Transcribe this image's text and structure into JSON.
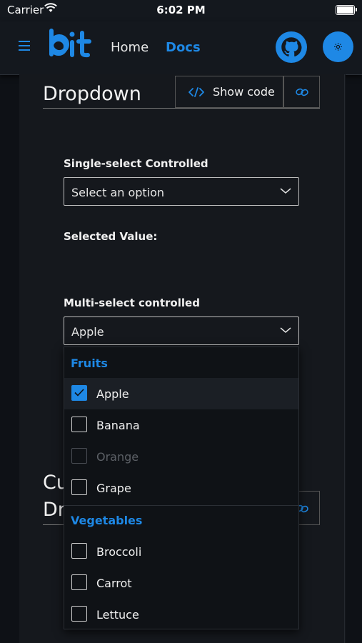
{
  "status_bar": {
    "carrier": "Carrier",
    "time": "6:02 PM"
  },
  "nav": {
    "logo": "bit",
    "home": "Home",
    "docs": "Docs",
    "github_icon": "github-icon",
    "theme_icon": "sun-icon"
  },
  "section": {
    "title": "Dropdown",
    "show_code": "Show code",
    "title2_line1": "Cu",
    "title2_line2": "Dr"
  },
  "single_select": {
    "label": "Single-select Controlled",
    "placeholder": "Select an option",
    "selected_value_label": "Selected Value:"
  },
  "multi_select": {
    "label": "Multi-select controlled",
    "value": "Apple",
    "groups": [
      {
        "header": "Fruits",
        "options": [
          {
            "text": "Apple",
            "checked": true,
            "disabled": false
          },
          {
            "text": "Banana",
            "checked": false,
            "disabled": false
          },
          {
            "text": "Orange",
            "checked": false,
            "disabled": true
          },
          {
            "text": "Grape",
            "checked": false,
            "disabled": false
          }
        ]
      },
      {
        "header": "Vegetables",
        "options": [
          {
            "text": "Broccoli",
            "checked": false,
            "disabled": false
          },
          {
            "text": "Carrot",
            "checked": false,
            "disabled": false
          },
          {
            "text": "Lettuce",
            "checked": false,
            "disabled": false
          }
        ]
      }
    ]
  },
  "colors": {
    "accent": "#1e88e5",
    "background": "#0e1116",
    "panel": "#15181d"
  }
}
